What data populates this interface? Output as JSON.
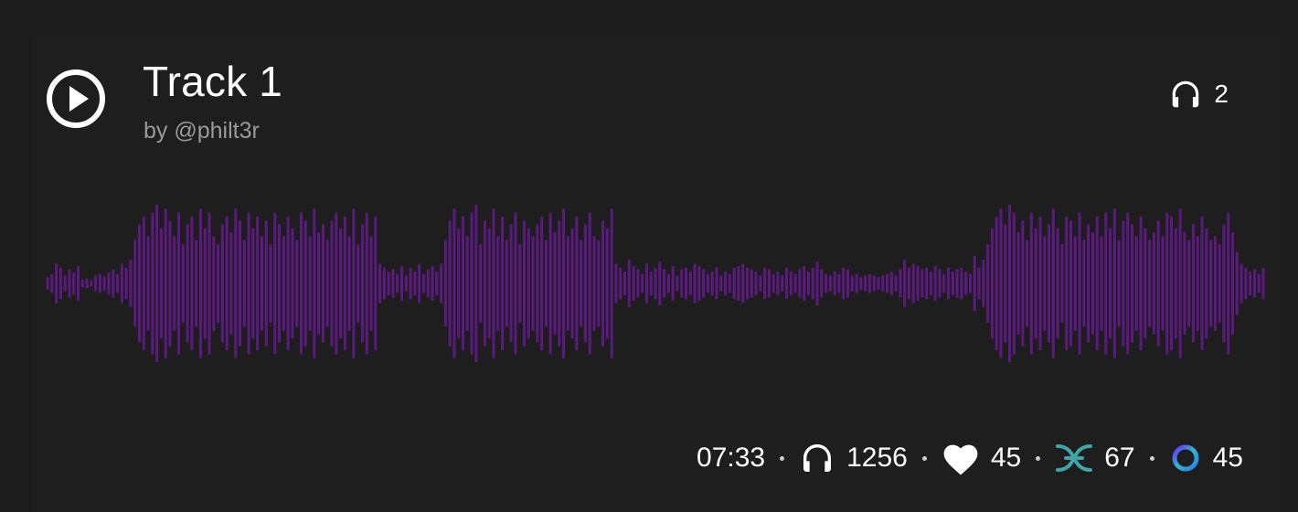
{
  "track": {
    "title": "Track 1",
    "byline": "by @philt3r"
  },
  "listeners_now": {
    "icon": "headphones-icon",
    "count": "2"
  },
  "stats": {
    "duration": "07:33",
    "plays": {
      "icon": "headphones-icon",
      "count": "1256"
    },
    "likes": {
      "icon": "heart-icon",
      "count": "45"
    },
    "reposts": {
      "icon": "audius-repost-icon",
      "count": "67"
    },
    "tips": {
      "icon": "ring-icon",
      "count": "45"
    }
  },
  "colors": {
    "background": "#1c1c1c",
    "waveform": "#5c1a80",
    "text": "#ffffff",
    "muted": "#9a9a9a",
    "repost": "#3fa6a9"
  },
  "waveform": {
    "amplitudes": [
      0.08,
      0.12,
      0.25,
      0.2,
      0.1,
      0.18,
      0.14,
      0.22,
      0.05,
      0.06,
      0.04,
      0.1,
      0.12,
      0.09,
      0.14,
      0.18,
      0.12,
      0.25,
      0.2,
      0.3,
      0.55,
      0.75,
      0.85,
      0.6,
      0.9,
      1.0,
      0.7,
      0.95,
      0.8,
      0.6,
      0.9,
      0.5,
      0.75,
      0.85,
      0.55,
      0.95,
      0.7,
      0.9,
      0.6,
      0.5,
      0.75,
      0.85,
      0.65,
      0.95,
      0.8,
      0.55,
      0.9,
      0.7,
      0.85,
      0.6,
      0.8,
      0.5,
      0.9,
      0.75,
      0.6,
      0.85,
      0.7,
      0.55,
      0.9,
      0.8,
      0.6,
      0.95,
      0.65,
      0.75,
      0.55,
      0.8,
      0.9,
      0.7,
      0.85,
      0.6,
      0.95,
      0.5,
      0.75,
      0.9,
      0.6,
      0.85,
      0.25,
      0.2,
      0.15,
      0.18,
      0.12,
      0.22,
      0.1,
      0.2,
      0.15,
      0.25,
      0.12,
      0.18,
      0.22,
      0.15,
      0.25,
      0.55,
      0.8,
      0.95,
      0.7,
      0.85,
      0.6,
      0.9,
      1.0,
      0.5,
      0.8,
      0.7,
      0.95,
      0.6,
      0.85,
      0.55,
      0.75,
      0.9,
      0.5,
      0.8,
      0.7,
      0.6,
      0.75,
      0.85,
      0.55,
      0.9,
      0.65,
      0.8,
      0.95,
      0.6,
      0.7,
      0.85,
      0.55,
      0.75,
      0.9,
      0.6,
      0.55,
      0.8,
      0.7,
      0.95,
      0.25,
      0.2,
      0.15,
      0.3,
      0.22,
      0.18,
      0.12,
      0.25,
      0.15,
      0.2,
      0.28,
      0.18,
      0.12,
      0.22,
      0.1,
      0.18,
      0.2,
      0.15,
      0.25,
      0.22,
      0.18,
      0.12,
      0.15,
      0.2,
      0.1,
      0.15,
      0.12,
      0.2,
      0.22,
      0.25,
      0.2,
      0.18,
      0.15,
      0.1,
      0.2,
      0.18,
      0.12,
      0.15,
      0.1,
      0.2,
      0.15,
      0.12,
      0.18,
      0.22,
      0.15,
      0.2,
      0.28,
      0.18,
      0.12,
      0.1,
      0.15,
      0.12,
      0.2,
      0.18,
      0.1,
      0.12,
      0.08,
      0.1,
      0.12,
      0.1,
      0.08,
      0.1,
      0.12,
      0.15,
      0.1,
      0.18,
      0.3,
      0.2,
      0.25,
      0.22,
      0.18,
      0.2,
      0.15,
      0.22,
      0.18,
      0.12,
      0.2,
      0.15,
      0.18,
      0.2,
      0.15,
      0.12,
      0.35,
      0.2,
      0.3,
      0.5,
      0.7,
      0.85,
      0.95,
      0.75,
      1.0,
      0.9,
      0.65,
      0.8,
      0.55,
      0.9,
      0.7,
      0.85,
      0.6,
      0.75,
      0.95,
      0.7,
      0.5,
      0.85,
      0.8,
      0.6,
      0.9,
      0.55,
      0.75,
      0.65,
      0.85,
      0.6,
      0.9,
      0.7,
      0.95,
      0.55,
      0.8,
      0.9,
      0.75,
      0.6,
      0.85,
      0.7,
      0.55,
      0.65,
      0.8,
      0.6,
      0.9,
      0.85,
      0.7,
      0.95,
      0.65,
      0.55,
      0.75,
      0.6,
      0.85,
      0.7,
      0.55,
      0.6,
      0.5,
      0.75,
      0.9,
      0.65,
      0.4,
      0.25,
      0.2,
      0.15,
      0.18,
      0.12,
      0.2
    ]
  }
}
